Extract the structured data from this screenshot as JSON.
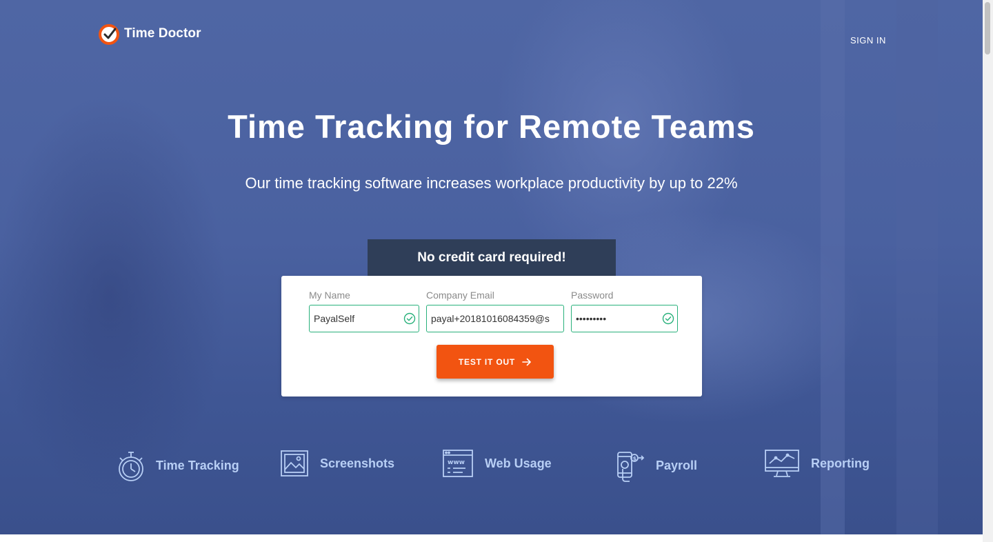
{
  "brand": {
    "name": "Time Doctor",
    "logo_icon": "clock-check-icon",
    "accent": "#f25411"
  },
  "nav": {
    "sign_in": "SIGN IN"
  },
  "hero": {
    "title": "Time Tracking for Remote Teams",
    "subtitle": "Our time tracking software increases workplace productivity by up to 22%"
  },
  "signup": {
    "banner": "No credit card required!",
    "fields": {
      "name": {
        "label": "My Name",
        "value": "PayalSelf",
        "valid": true
      },
      "email": {
        "label": "Company Email",
        "value": "payal+20181016084359@s"
      },
      "password": {
        "label": "Password",
        "value": "•••••••••",
        "valid": true
      }
    },
    "submit": {
      "label": "TEST IT OUT",
      "icon": "arrow-right-icon"
    }
  },
  "features": [
    {
      "label": "Time Tracking",
      "icon": "stopwatch-icon"
    },
    {
      "label": "Screenshots",
      "icon": "image-icon"
    },
    {
      "label": "Web Usage",
      "icon": "browser-www-icon"
    },
    {
      "label": "Payroll",
      "icon": "phone-payment-icon"
    },
    {
      "label": "Reporting",
      "icon": "chart-monitor-icon"
    }
  ],
  "colors": {
    "hero_overlay": "#4a61a0",
    "field_valid": "#27b07a",
    "banner_bg": "#2f3e58",
    "feature_text": "#b8cff5"
  }
}
